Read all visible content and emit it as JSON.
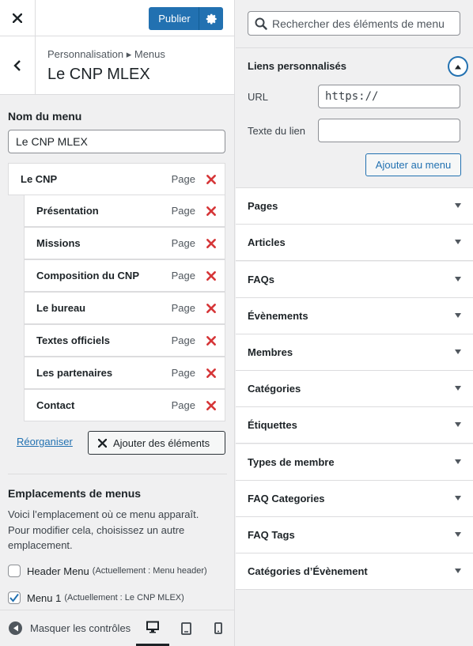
{
  "topbar": {
    "publish_label": "Publier"
  },
  "header": {
    "breadcrumb": "Personnalisation ▸ Menus",
    "title": "Le CNP MLEX"
  },
  "menu_name": {
    "label": "Nom du menu",
    "value": "Le CNP MLEX"
  },
  "menu_items": [
    {
      "title": "Le CNP",
      "type": "Page"
    },
    {
      "title": "Présentation",
      "type": "Page"
    },
    {
      "title": "Missions",
      "type": "Page"
    },
    {
      "title": "Composition du CNP",
      "type": "Page"
    },
    {
      "title": "Le bureau",
      "type": "Page"
    },
    {
      "title": "Textes officiels",
      "type": "Page"
    },
    {
      "title": "Les partenaires",
      "type": "Page"
    },
    {
      "title": "Contact",
      "type": "Page"
    }
  ],
  "actions": {
    "reorganise": "Réorganiser",
    "add_items": "Ajouter des éléments"
  },
  "locations": {
    "title": "Emplacements de menus",
    "description": "Voici l’emplacement où ce menu apparaît. Pour modifier cela, choisissez un autre emplacement.",
    "items": [
      {
        "label": "Header Menu",
        "note": "(Actuellement : Menu header)",
        "checked": false
      },
      {
        "label": "Menu 1",
        "note": "(Actuellement : Le CNP MLEX)",
        "checked": true
      }
    ]
  },
  "footer": {
    "hide_controls": "Masquer les contrôles"
  },
  "search": {
    "placeholder": "Rechercher des éléments de menu"
  },
  "custom_links": {
    "title": "Liens personnalisés",
    "url_label": "URL",
    "url_value": "https://",
    "link_text_label": "Texte du lien",
    "link_text_value": "",
    "add_button": "Ajouter au menu"
  },
  "sections": [
    "Pages",
    "Articles",
    "FAQs",
    "Évènements",
    "Membres",
    "Catégories",
    "Étiquettes",
    "Types de membre",
    "FAQ Categories",
    "FAQ Tags",
    "Catégories d’Évènement"
  ],
  "colors": {
    "accent": "#2271b1",
    "delete": "#d63638"
  }
}
